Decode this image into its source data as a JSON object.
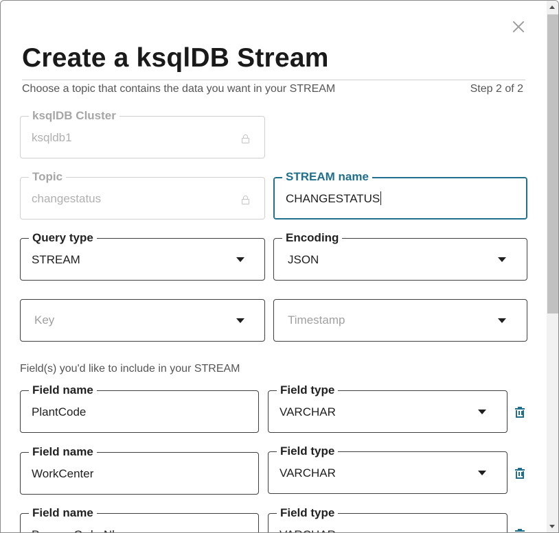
{
  "dialog": {
    "title": "Create a ksqlDB Stream",
    "subtitle": "Choose a topic that contains the data you want in your STREAM",
    "step": "Step 2 of 2",
    "close_icon": "close-icon"
  },
  "form": {
    "cluster": {
      "label": "ksqlDB Cluster",
      "value": "ksqldb1",
      "disabled": true,
      "icon": "lock-icon"
    },
    "topic": {
      "label": "Topic",
      "value": "changestatus",
      "disabled": true,
      "icon": "lock-icon"
    },
    "stream_name": {
      "label": "STREAM name",
      "value": "CHANGESTATUS",
      "focused": true
    },
    "query_type": {
      "label": "Query type",
      "value": "STREAM",
      "icon": "dropdown-arrow-icon"
    },
    "encoding": {
      "label": "Encoding",
      "value": "JSON",
      "icon": "dropdown-arrow-icon"
    },
    "key": {
      "placeholder": "Key",
      "icon": "dropdown-arrow-icon"
    },
    "timestamp": {
      "placeholder": "Timestamp",
      "icon": "dropdown-arrow-icon"
    }
  },
  "fields_section": {
    "label": "Field(s) you'd like to include in your STREAM",
    "rows": [
      {
        "name_label": "Field name",
        "name_value": "PlantCode",
        "type_label": "Field type",
        "type_value": "VARCHAR"
      },
      {
        "name_label": "Field name",
        "name_value": "WorkCenter",
        "type_label": "Field type",
        "type_value": "VARCHAR"
      },
      {
        "name_label": "Field name",
        "name_value": "ProcessOrderNb",
        "type_label": "Field type",
        "type_value": "VARCHAR"
      }
    ],
    "delete_icon": "trash-icon"
  },
  "colors": {
    "accent": "#1e6e8c",
    "border": "#3d3d3d",
    "disabled_border": "#cfcfcf",
    "text": "#1f1f1f",
    "muted": "#555555"
  }
}
